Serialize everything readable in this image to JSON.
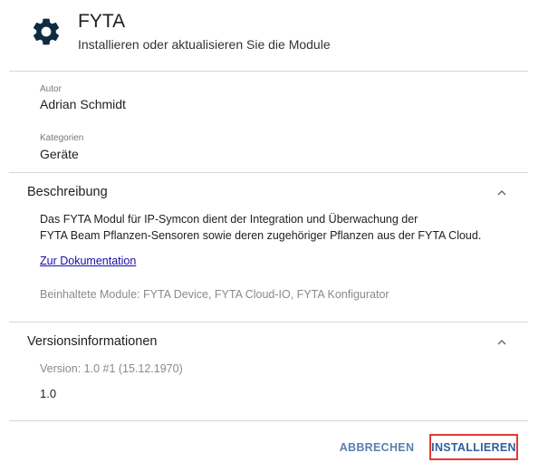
{
  "header": {
    "icon": "gear-icon",
    "title": "FYTA",
    "subtitle": "Installieren oder aktualisieren Sie die Module"
  },
  "info": {
    "author_label": "Autor",
    "author_value": "Adrian Schmidt",
    "categories_label": "Kategorien",
    "categories_value": "Geräte"
  },
  "description": {
    "title": "Beschreibung",
    "line1": "Das FYTA Modul für IP-Symcon dient der Integration und Überwachung der",
    "line2": "FYTA Beam Pflanzen-Sensoren sowie deren zugehöriger Pflanzen aus der FYTA Cloud.",
    "doc_link": "Zur Dokumentation",
    "modules": "Beinhaltete Module: FYTA Device, FYTA Cloud-IO, FYTA Konfigurator"
  },
  "versions": {
    "title": "Versionsinformationen",
    "version_line": "Version: 1.0 #1 (15.12.1970)",
    "value": "1.0"
  },
  "actions": {
    "cancel_label": "ABBRECHEN",
    "install_label": "INSTALLIEREN"
  },
  "colors": {
    "accent": "#4a72a8",
    "highlight_border": "#e53935",
    "link": "#1a0dab"
  }
}
